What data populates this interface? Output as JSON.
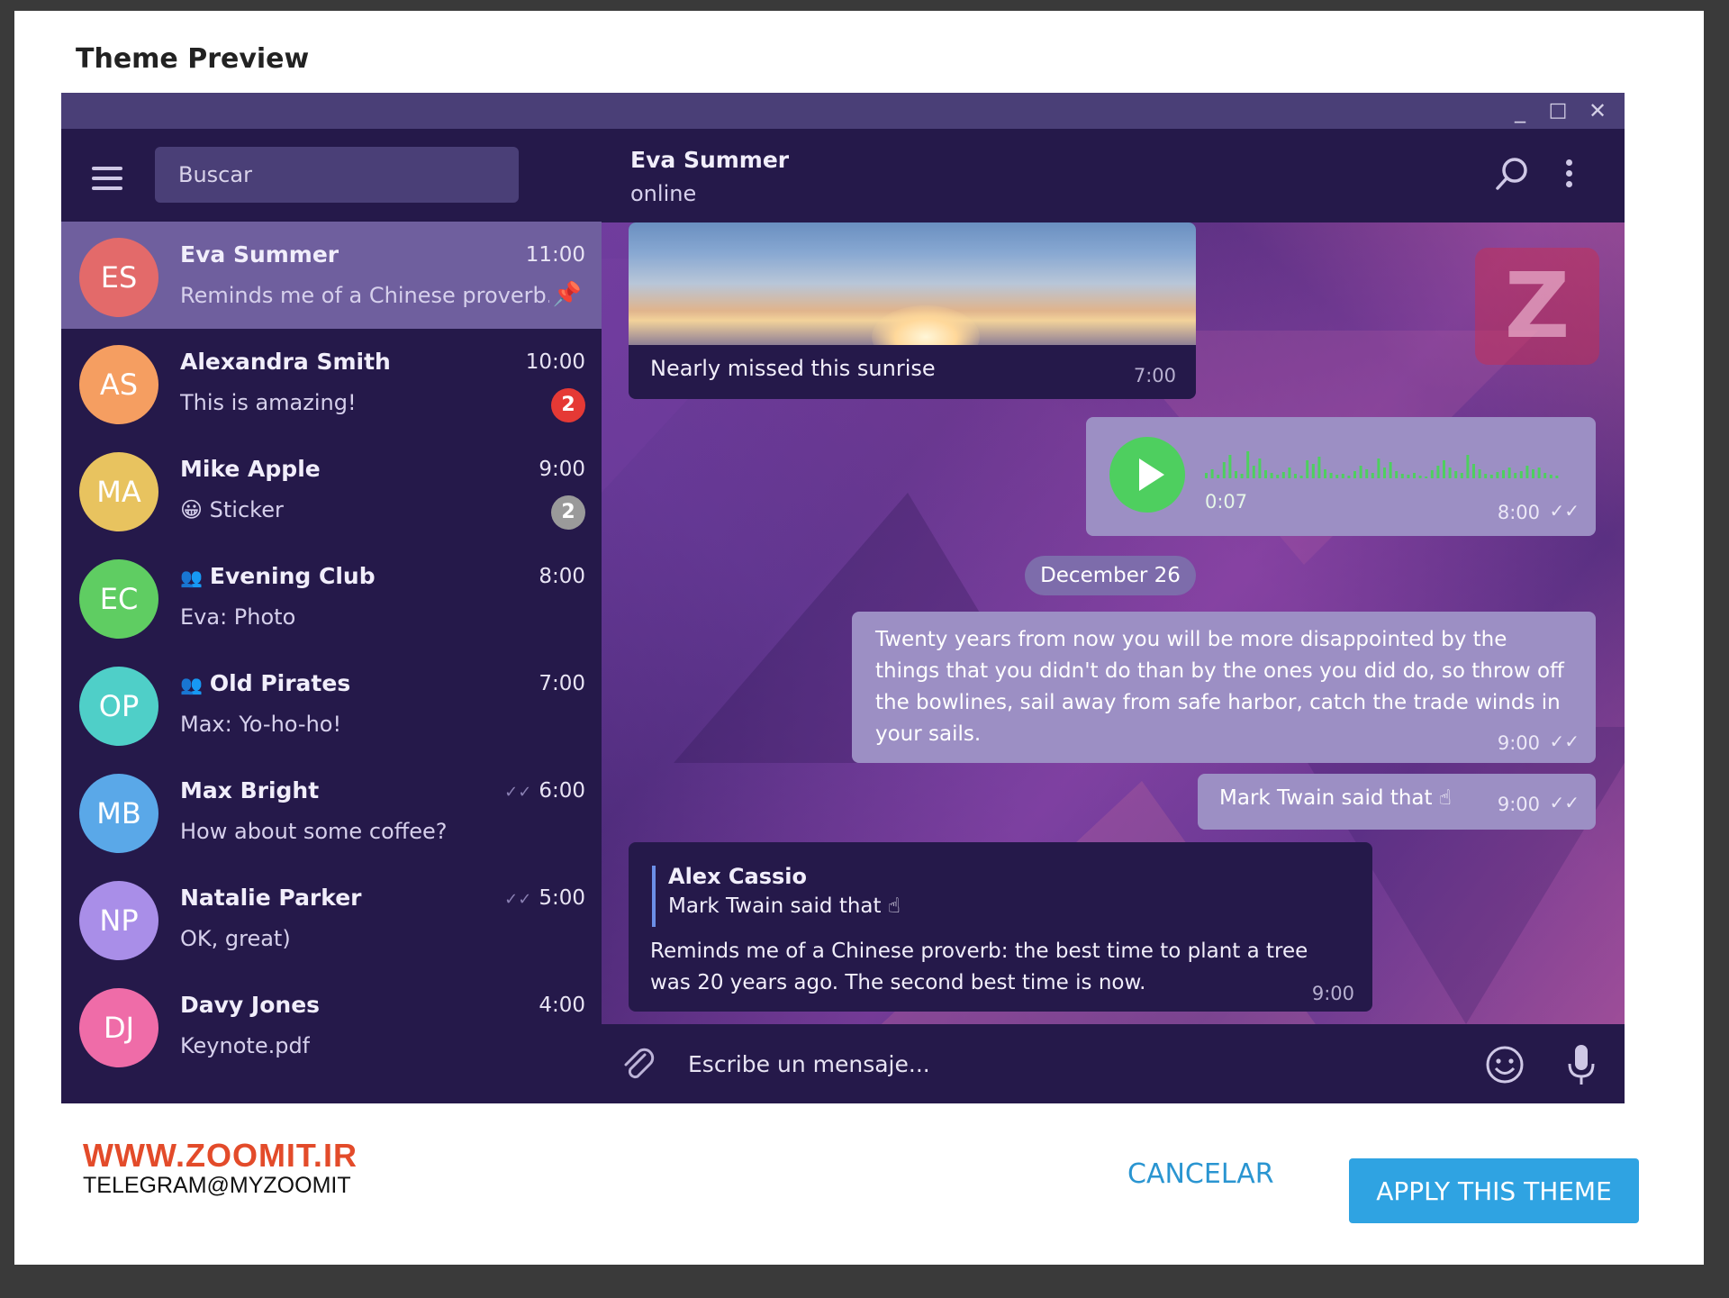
{
  "dialog": {
    "title": "Theme Preview"
  },
  "window_controls": {
    "minimize": "_",
    "maximize": "□",
    "close": "✕"
  },
  "sidebar": {
    "search_placeholder": "Buscar",
    "chats": [
      {
        "initials": "ES",
        "name": "Eva Summer",
        "preview": "Reminds me of a Chinese proverb...",
        "time": "11:00",
        "avatar_color": "#e36a6a",
        "pinned": true
      },
      {
        "initials": "AS",
        "name": "Alexandra Smith",
        "preview": "This is amazing!",
        "time": "10:00",
        "avatar_color": "#f59e61",
        "badge": "2",
        "badge_color": "#e53935"
      },
      {
        "initials": "MA",
        "name": "Mike Apple",
        "preview": "😀 Sticker",
        "time": "9:00",
        "avatar_color": "#e8c35f",
        "badge": "2",
        "badge_color": "#9a9a9a"
      },
      {
        "initials": "EC",
        "name": "Evening Club",
        "preview": "Eva: Photo",
        "time": "8:00",
        "avatar_color": "#5fcd62",
        "group": true
      },
      {
        "initials": "OP",
        "name": "Old Pirates",
        "preview": "Max: Yo-ho-ho!",
        "time": "7:00",
        "avatar_color": "#4fcfc8",
        "group": true
      },
      {
        "initials": "MB",
        "name": "Max Bright",
        "preview": "How about some coffee?",
        "time": "6:00",
        "avatar_color": "#5aa8e8",
        "read": true
      },
      {
        "initials": "NP",
        "name": "Natalie Parker",
        "preview": "OK, great)",
        "time": "5:00",
        "avatar_color": "#a98ee8",
        "read": true
      },
      {
        "initials": "DJ",
        "name": "Davy Jones",
        "preview": "Keynote.pdf",
        "time": "4:00",
        "avatar_color": "#ef6ca8"
      }
    ]
  },
  "chat": {
    "peer_name": "Eva Summer",
    "peer_status": "online",
    "photo_caption": "Nearly missed this sunrise",
    "photo_time": "7:00",
    "voice_duration": "0:07",
    "voice_time": "8:00",
    "date_separator": "December 26",
    "quote_message": "Twenty years from now you will be more disappointed by the things that you didn't do than by the ones you did do, so throw off the bowlines, sail away from safe harbor, catch the trade winds in your sails.",
    "quote_time": "9:00",
    "mark_message": "Mark Twain said that ☝",
    "mark_time": "9:00",
    "reply_author": "Alex Cassio",
    "reply_quote": "Mark Twain said that ☝",
    "reply_message": "Reminds me of a Chinese proverb: the best time to plant a tree was 20 years ago. The second best time is now.",
    "reply_time": "9:00",
    "composer_placeholder": "Escribe un mensaje..."
  },
  "footer": {
    "watermark_site": "WWW.ZOOMIT.IR",
    "watermark_telegram": "TELEGRAM@MYZOOMIT",
    "cancel_label": "CANCELAR",
    "apply_label": "APPLY THIS THEME"
  },
  "colors": {
    "window_bg": "#25194a",
    "titlebar": "#4a3f77",
    "active_row": "#6f5f9e",
    "outgoing_bubble": "#9c8fc4",
    "play_button": "#4ecf5f",
    "apply_button": "#2fa3e2",
    "cancel_text": "#2a95d1"
  },
  "icons": [
    "hamburger-icon",
    "search-icon",
    "more-vert-icon",
    "pin-icon",
    "group-icon",
    "double-check-icon",
    "play-icon",
    "attach-icon",
    "emoji-icon",
    "mic-icon",
    "minimize-icon",
    "maximize-icon",
    "close-icon"
  ]
}
